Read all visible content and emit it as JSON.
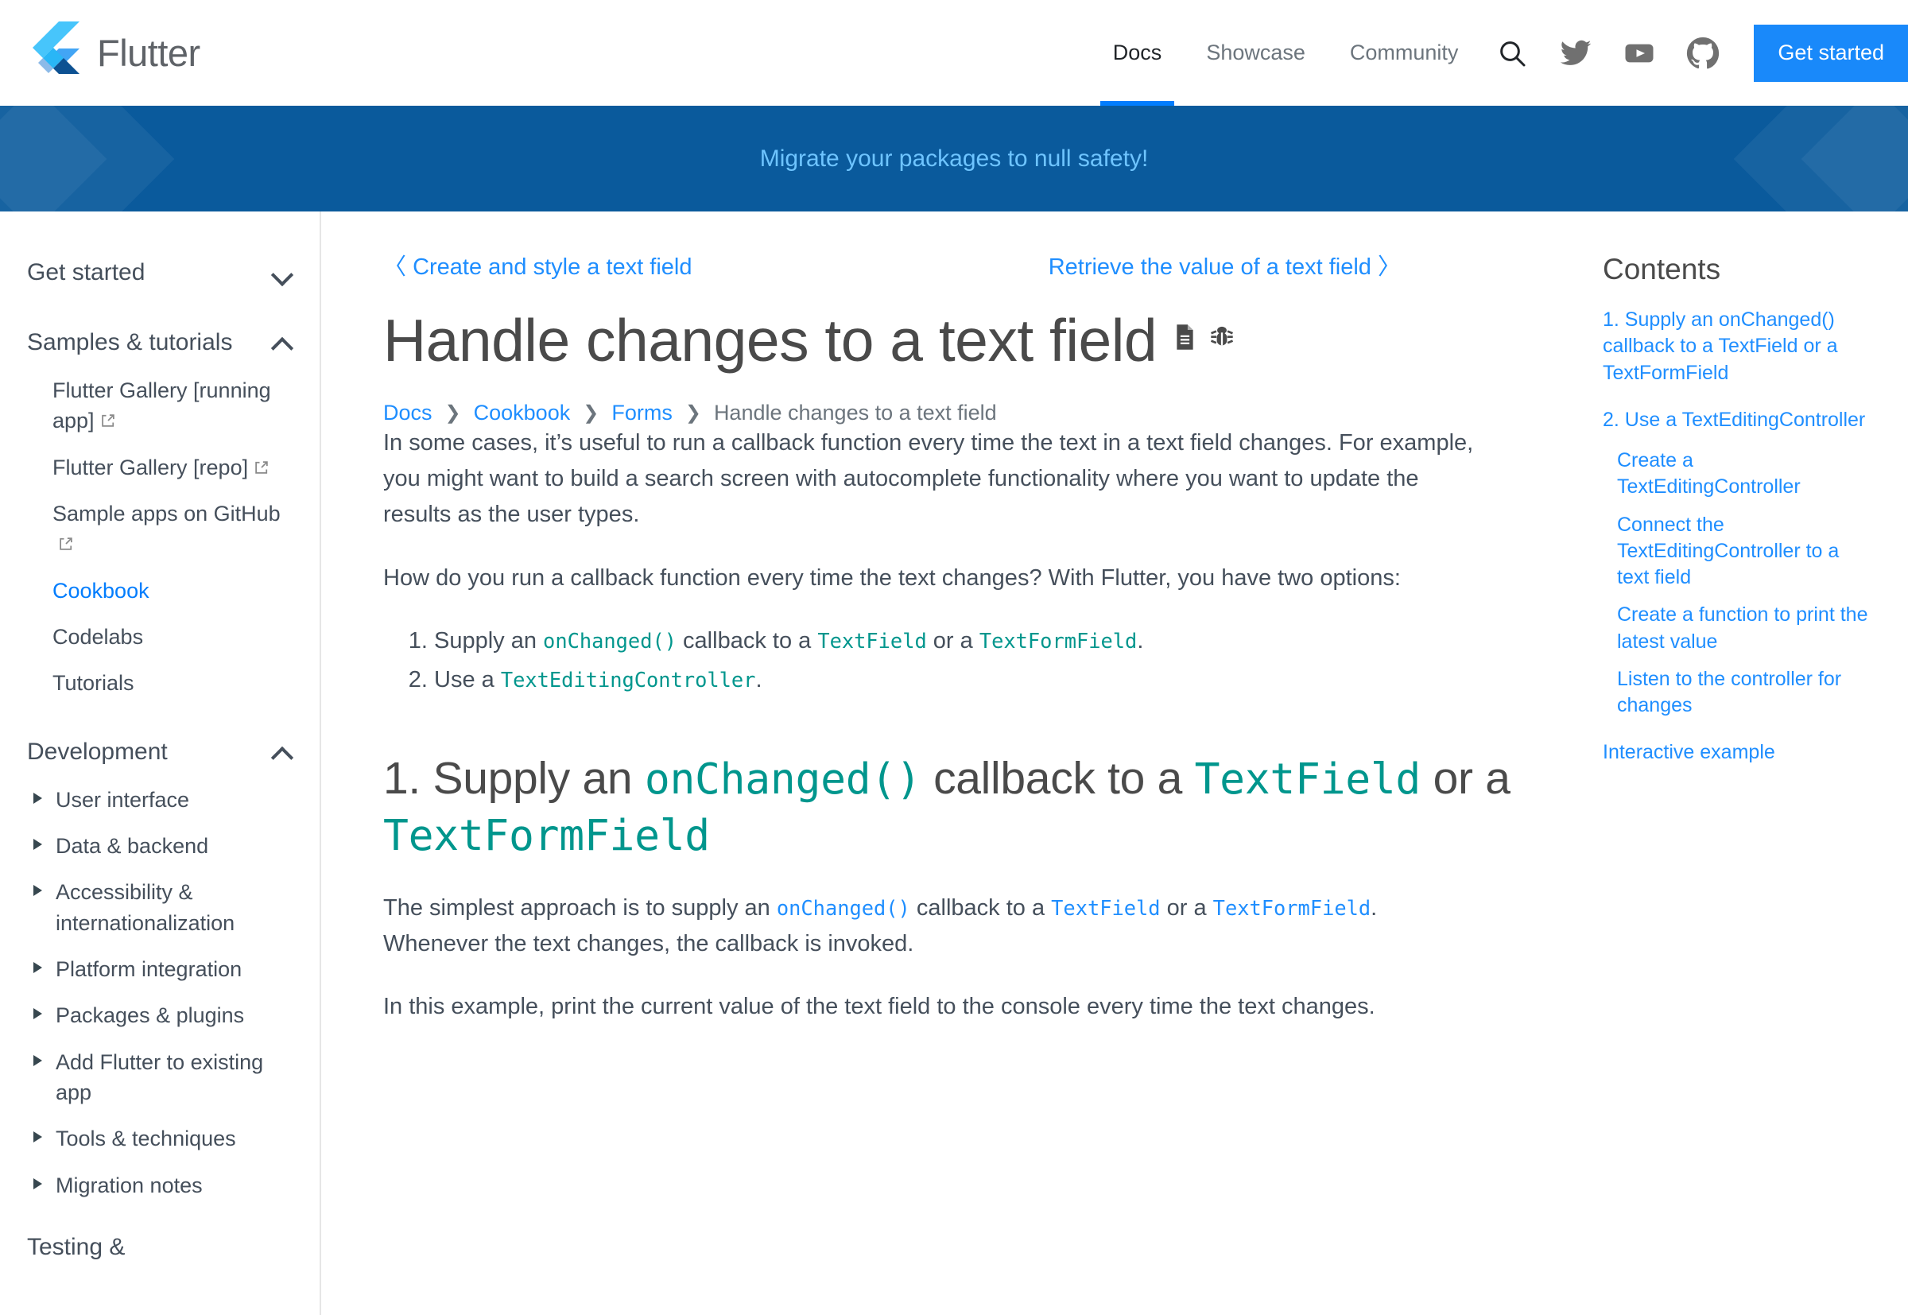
{
  "header": {
    "brand_name": "Flutter",
    "nav": [
      {
        "label": "Docs",
        "active": true
      },
      {
        "label": "Showcase",
        "active": false
      },
      {
        "label": "Community",
        "active": false
      }
    ],
    "icons": [
      "search-icon",
      "twitter-icon",
      "youtube-icon",
      "github-icon"
    ],
    "cta_label": "Get started"
  },
  "banner": {
    "text": "Migrate your packages to null safety!"
  },
  "sidebar": {
    "sections": [
      {
        "label": "Get started",
        "state": "collapsed",
        "items": []
      },
      {
        "label": "Samples & tutorials",
        "state": "expanded",
        "items": [
          {
            "label": "Flutter Gallery [running app]",
            "external": true,
            "active": false
          },
          {
            "label": "Flutter Gallery [repo]",
            "external": true,
            "active": false
          },
          {
            "label": "Sample apps on GitHub",
            "external": true,
            "active": false
          },
          {
            "label": "Cookbook",
            "external": false,
            "active": true
          },
          {
            "label": "Codelabs",
            "external": false,
            "active": false
          },
          {
            "label": "Tutorials",
            "external": false,
            "active": false
          }
        ]
      },
      {
        "label": "Development",
        "state": "expanded",
        "items": [
          {
            "label": "User interface",
            "collapsible": true
          },
          {
            "label": "Data & backend",
            "collapsible": true
          },
          {
            "label": "Accessibility & internationalization",
            "collapsible": true
          },
          {
            "label": "Platform integration",
            "collapsible": true
          },
          {
            "label": "Packages & plugins",
            "collapsible": true
          },
          {
            "label": "Add Flutter to existing app",
            "collapsible": true
          },
          {
            "label": "Tools & techniques",
            "collapsible": true
          },
          {
            "label": "Migration notes",
            "collapsible": true
          }
        ]
      },
      {
        "label": "Testing &",
        "state": "cutoff",
        "items": []
      }
    ]
  },
  "page": {
    "prev_link": "Create and style a text field",
    "next_link": "Retrieve the value of a text field",
    "prev_chevron": "〈",
    "next_chevron": "〉",
    "title": "Handle changes to a text field",
    "title_icons": [
      "page-source-icon",
      "bug-report-icon"
    ],
    "breadcrumb": [
      {
        "label": "Docs",
        "link": true
      },
      {
        "label": "Cookbook",
        "link": true
      },
      {
        "label": "Forms",
        "link": true
      },
      {
        "label": "Handle changes to a text field",
        "link": false
      }
    ],
    "breadcrumb_separator": "❯",
    "paragraph_1": "In some cases, it’s useful to run a callback function every time the text in a text field changes. For example, you might want to build a search screen with autocomplete functionality where you want to update the results as the user types.",
    "paragraph_2": "How do you run a callback function every time the text changes? With Flutter, you have two options:",
    "steps": [
      {
        "parts": [
          {
            "text": "Supply an ",
            "style": "plain"
          },
          {
            "text": "onChanged()",
            "style": "code-teal"
          },
          {
            "text": " callback to a ",
            "style": "plain"
          },
          {
            "text": "TextField",
            "style": "code-teal"
          },
          {
            "text": " or a ",
            "style": "plain"
          },
          {
            "text": "TextFormField",
            "style": "code-teal"
          },
          {
            "text": ".",
            "style": "plain"
          }
        ]
      },
      {
        "parts": [
          {
            "text": "Use a ",
            "style": "plain"
          },
          {
            "text": "TextEditingController",
            "style": "code-teal"
          },
          {
            "text": ".",
            "style": "plain"
          }
        ]
      }
    ],
    "section_heading": [
      {
        "text": "1. Supply an ",
        "style": "plain"
      },
      {
        "text": "onChanged()",
        "style": "code-teal"
      },
      {
        "text": " callback to a ",
        "style": "plain"
      },
      {
        "text": "TextField",
        "style": "code-teal"
      },
      {
        "text": " or a ",
        "style": "plain"
      },
      {
        "text": "TextFormField",
        "style": "code-teal"
      }
    ],
    "paragraph_3": [
      {
        "text": "The simplest approach is to supply an ",
        "style": "plain"
      },
      {
        "text": "onChanged()",
        "style": "code-blue"
      },
      {
        "text": " callback to a ",
        "style": "plain"
      },
      {
        "text": "TextField",
        "style": "code-blue"
      },
      {
        "text": " or a ",
        "style": "plain"
      },
      {
        "text": "TextFormField",
        "style": "code-blue"
      },
      {
        "text": ". Whenever the text changes, the callback is invoked.",
        "style": "plain"
      }
    ],
    "paragraph_4": "In this example, print the current value of the text field to the console every time the text changes."
  },
  "toc": {
    "title": "Contents",
    "items": [
      {
        "label": "1. Supply an onChanged() callback to a TextField or a TextFormField",
        "level": 1,
        "spaced": false
      },
      {
        "label": "2. Use a TextEditingController",
        "level": 1,
        "spaced": true
      },
      {
        "label": "Create a TextEditingController",
        "level": 2,
        "spaced": false
      },
      {
        "label": "Connect the TextEditingController to a text field",
        "level": 2,
        "spaced": false
      },
      {
        "label": "Create a function to print the latest value",
        "level": 2,
        "spaced": false
      },
      {
        "label": "Listen to the controller for changes",
        "level": 2,
        "spaced": false
      },
      {
        "label": "Interactive example",
        "level": 1,
        "spaced": true
      }
    ]
  },
  "colors": {
    "accent_blue": "#027dfd",
    "link_blue": "#1f8eff",
    "banner_blue": "#0a5a9c",
    "code_teal": "#00968d",
    "text_gray": "#454f5b"
  }
}
